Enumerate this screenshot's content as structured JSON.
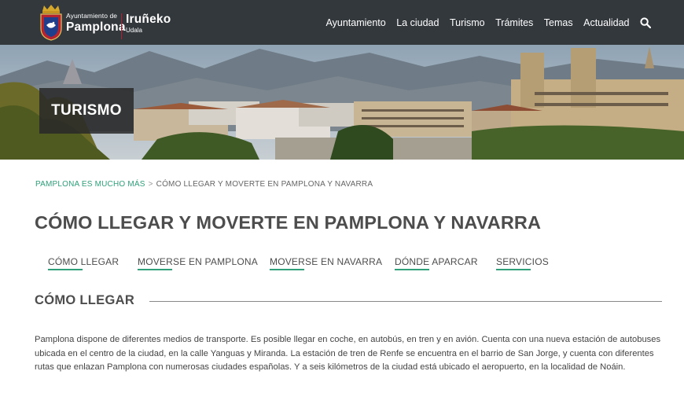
{
  "header": {
    "logo_line1": "Ayuntamiento de",
    "logo_line2": "Pamplona",
    "logo_alt_line1": "Iruñeko",
    "logo_alt_line2": "Udala",
    "nav": [
      "Ayuntamiento",
      "La ciudad",
      "Turismo",
      "Trámites",
      "Temas",
      "Actualidad"
    ],
    "search_icon": "search-icon"
  },
  "hero": {
    "badge": "TURISMO"
  },
  "breadcrumb": {
    "link": "PAMPLONA ES MUCHO MÁS",
    "separator": ">",
    "current": "CÓMO LLEGAR Y MOVERTE EN PAMPLONA Y NAVARRA"
  },
  "page": {
    "title": "CÓMO LLEGAR Y MOVERTE EN PAMPLONA Y NAVARRA"
  },
  "tabs": [
    "CÓMO LLEGAR",
    "MOVERSE EN PAMPLONA",
    "MOVERSE EN NAVARRA",
    "DÓNDE APARCAR",
    "SERVICIOS"
  ],
  "section": {
    "title": "CÓMO LLEGAR",
    "body": "Pamplona dispone de diferentes medios de transporte. Es posible llegar en coche, en autobús, en tren y en avión. Cuenta con una nueva estación de autobuses ubicada en el centro de la ciudad, en la calle Yanguas y Miranda. La estación de tren de Renfe se encuentra en el barrio de San Jorge, y cuenta con diferentes rutas que enlazan Pamplona con numerosas ciudades españolas. Y a seis kilómetros de la ciudad está ubicado el aeropuerto, en la localidad de Noáin."
  },
  "colors": {
    "header_bg": "#33383d",
    "accent_green": "#2fa07a",
    "logo_red": "#b02030",
    "title_gray": "#4d4d4d"
  }
}
